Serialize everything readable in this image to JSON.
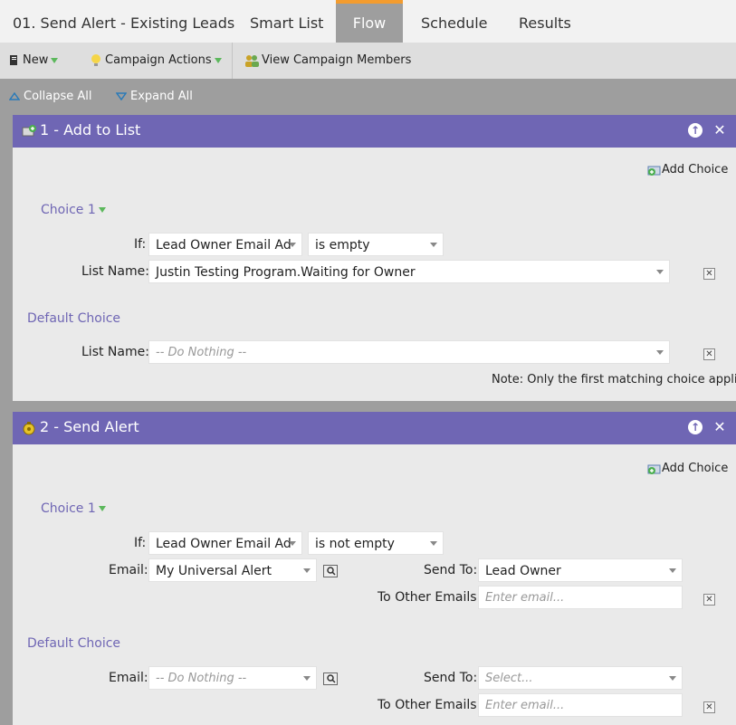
{
  "tabs": {
    "campaign_name": "01. Send Alert - Existing Leads",
    "smart_list": "Smart List",
    "flow": "Flow",
    "schedule": "Schedule",
    "results": "Results"
  },
  "toolbar": {
    "new": "New",
    "campaign_actions": "Campaign Actions",
    "view_members": "View Campaign Members"
  },
  "expandbar": {
    "collapse_all": "Collapse All",
    "expand_all": "Expand All"
  },
  "step1": {
    "title": "1 - Add to List",
    "add_choice": "Add Choice",
    "choice_label": "Choice 1",
    "if_label": "If:",
    "if_field": "Lead Owner Email Ad",
    "if_operator": "is empty",
    "list_label": "List Name:",
    "list_value": "Justin Testing Program.Waiting for Owner",
    "default_label": "Default Choice",
    "default_list_label": "List Name:",
    "default_list_value": "-- Do Nothing --",
    "note": "Note: Only the first matching choice applies"
  },
  "step2": {
    "title": "2 - Send Alert",
    "add_choice": "Add Choice",
    "choice_label": "Choice 1",
    "if_label": "If:",
    "if_field": "Lead Owner Email Ad",
    "if_operator": "is not empty",
    "email_label": "Email:",
    "email_value": "My Universal Alert",
    "send_to_label": "Send To:",
    "send_to_value": "Lead Owner",
    "other_emails_label": "To Other Emails:",
    "other_emails_placeholder": "Enter email...",
    "default_label": "Default Choice",
    "default_email_label": "Email:",
    "default_email_value": "-- Do Nothing --",
    "default_send_to_label": "Send To:",
    "default_send_to_value": "Select...",
    "default_other_emails_label": "To Other Emails:",
    "default_other_emails_placeholder": "Enter email..."
  },
  "colors": {
    "accent_purple": "#6f66b4",
    "tab_active_border": "#f39c2f",
    "dropdown_green": "#5cb85c"
  },
  "icons": [
    "document-icon",
    "lightbulb-icon",
    "members-icon",
    "triangle-up-icon",
    "triangle-down-icon",
    "add-to-list-icon",
    "send-alert-icon",
    "arrow-up-icon",
    "close-icon",
    "add-choice-icon",
    "delete-icon",
    "lookup-icon"
  ]
}
